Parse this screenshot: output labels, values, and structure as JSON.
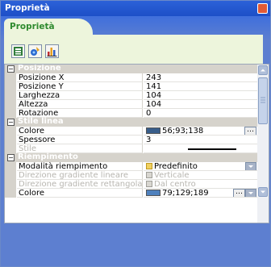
{
  "window": {
    "title": "Proprietà",
    "close_glyph": "×"
  },
  "tab": {
    "label": "Proprietà"
  },
  "toolbar": {
    "buttons": [
      {
        "name": "categorized-view-icon"
      },
      {
        "name": "style-palette-icon"
      },
      {
        "name": "chart-icon"
      }
    ]
  },
  "categories": {
    "posizione": "Posizione",
    "stile_linea": "Stile linea",
    "riempimento": "Riempimento"
  },
  "props": {
    "pos_x": {
      "name": "Posizione X",
      "value": "243"
    },
    "pos_y": {
      "name": "Posizione Y",
      "value": "141"
    },
    "larghezza": {
      "name": "Larghezza",
      "value": "104"
    },
    "altezza": {
      "name": "Altezza",
      "value": "104"
    },
    "rotazione": {
      "name": "Rotazione",
      "value": "0"
    },
    "colore_linea": {
      "name": "Colore",
      "value": "56;93;138",
      "color": "#385d8a"
    },
    "spessore": {
      "name": "Spessore",
      "value": "3"
    },
    "stile": {
      "name": "Stile"
    },
    "modalita": {
      "name": "Modalità riempimento",
      "value": "Predefinito"
    },
    "dir_lineare": {
      "name": "Direzione gradiente lineare",
      "value": "Verticale"
    },
    "dir_rett": {
      "name": "Direzione gradiente rettangolare",
      "value": "Dal centro"
    },
    "colore_riemp": {
      "name": "Colore",
      "value": "79;129;189",
      "color": "#4f81bd"
    }
  },
  "glyphs": {
    "expand": "…",
    "toggle_minus": "−"
  }
}
